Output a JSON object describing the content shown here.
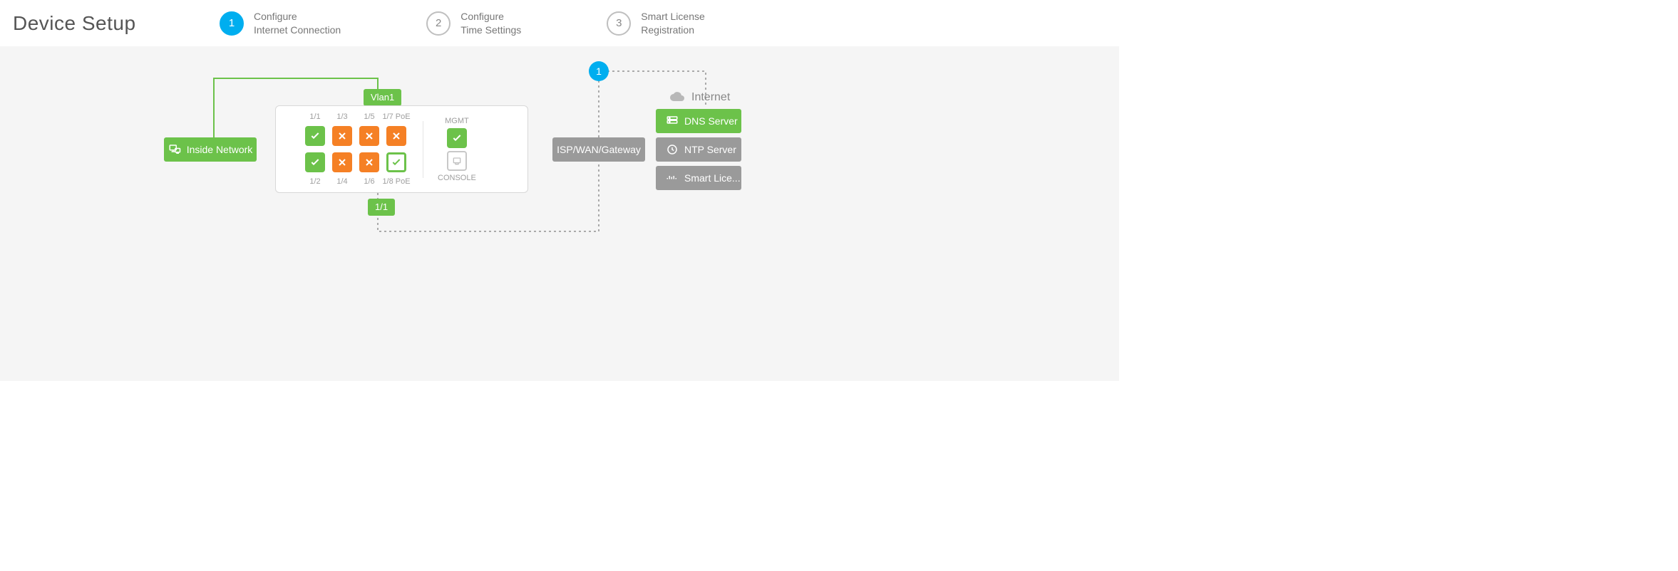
{
  "title": "Device Setup",
  "steps": [
    {
      "num": "1",
      "l1": "Configure",
      "l2": "Internet Connection",
      "active": true
    },
    {
      "num": "2",
      "l1": "Configure",
      "l2": "Time Settings",
      "active": false
    },
    {
      "num": "3",
      "l1": "Smart License",
      "l2": "Registration",
      "active": false
    }
  ],
  "ports_top": [
    "1/1",
    "1/3",
    "1/5",
    "1/7 PoE"
  ],
  "ports_bottom": [
    "1/2",
    "1/4",
    "1/6",
    "1/8 PoE"
  ],
  "mgmt_label": "MGMT",
  "console_label": "CONSOLE",
  "port_status_row1": [
    "green-check",
    "orange-x",
    "orange-x",
    "orange-x"
  ],
  "port_status_row2": [
    "green-check",
    "orange-x",
    "orange-x",
    "green-ring-check"
  ],
  "vlan_tag": "Vlan1",
  "outside_tag": "1/1",
  "inside_btn": "Inside Network",
  "isp_btn": "ISP/WAN/Gateway",
  "internet_label": "Internet",
  "servers": [
    {
      "label": "DNS Server",
      "color": "green",
      "icon": "server"
    },
    {
      "label": "NTP Server",
      "color": "gray",
      "icon": "clock"
    },
    {
      "label": "Smart Lice...",
      "color": "gray",
      "icon": "cisco"
    }
  ],
  "badge_num": "1"
}
